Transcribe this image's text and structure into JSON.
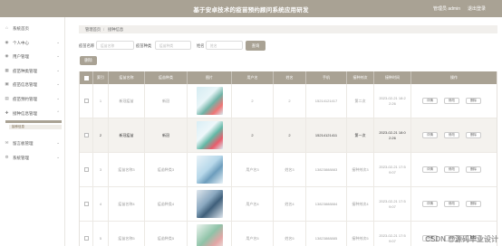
{
  "header": {
    "title": "基于安卓技术的疫苗预约顾问系统应用研发",
    "admin": "管理员 admin",
    "logout": "退出登录"
  },
  "sidebar": {
    "items": [
      {
        "label": "系统首页",
        "icon": "home-icon"
      },
      {
        "label": "个人中心",
        "icon": "user-icon"
      },
      {
        "label": "用户管理",
        "icon": "users-icon"
      },
      {
        "label": "疫苗种类管理",
        "icon": "grid-icon"
      },
      {
        "label": "疫苗信息管理",
        "icon": "box-icon"
      },
      {
        "label": "疫苗预约管理",
        "icon": "calendar-icon"
      },
      {
        "label": "接种信息管理",
        "icon": "syringe-icon"
      },
      {
        "label": "留言板管理",
        "icon": "message-icon"
      },
      {
        "label": "系统管理",
        "icon": "gear-icon"
      }
    ],
    "sub_item": "接种信息"
  },
  "breadcrumb": {
    "home": "管理首页",
    "current": "接种信息"
  },
  "search": {
    "field1_label": "疫苗名称",
    "field1_placeholder": "疫苗名称",
    "field2_label": "疫苗种类",
    "field2_placeholder": "疫苗种类",
    "field3_label": "姓名",
    "field3_placeholder": "姓名",
    "button": "查询"
  },
  "delete_button": "删除",
  "table": {
    "headers": [
      "",
      "索引",
      "疫苗名称",
      "疫苗种类",
      "图片",
      "用户名",
      "姓名",
      "手机",
      "接种剂次",
      "接种时间",
      "操作"
    ],
    "rows": [
      {
        "index": "1",
        "vaccine": "新冠疫苗",
        "kind": "新冠",
        "user": "2",
        "name": "2",
        "phone": "15214121417",
        "dose": "第二次",
        "time": "2023-02-21 18:2",
        "time2": "2:26",
        "image_colors": [
          "#6fb3a6",
          "#d5ecf2",
          "#f07575"
        ],
        "dim": true
      },
      {
        "index": "2",
        "vaccine": "新冠疫苗",
        "kind": "新冠",
        "user": "2",
        "name": "2",
        "phone": "15214121411",
        "dose": "第一次",
        "time": "2023-02-21 18:0",
        "time2": "2:26",
        "image_colors": [
          "#64b8a6",
          "#d8eef5",
          "#e95c6b"
        ],
        "dim": false
      },
      {
        "index": "3",
        "vaccine": "疫苗名称3",
        "kind": "疫苗种类3",
        "user": "用户名3",
        "name": "姓名3",
        "phone": "13823888883",
        "dose": "接种剂次3",
        "time": "2023-02-21 17:5",
        "time2": "9:07",
        "image_colors": [
          "#b7d8ea",
          "#e9f3f8",
          "#6d9dbc"
        ],
        "dim": true
      },
      {
        "index": "4",
        "vaccine": "疫苗名称4",
        "kind": "疫苗种类4",
        "user": "用户名4",
        "name": "姓名4",
        "phone": "13823888884",
        "dose": "接种剂次4",
        "time": "2023-02-21 17:5",
        "time2": "9:07",
        "image_colors": [
          "#3f5f7a",
          "#dfe7ee",
          "#8aa8c0"
        ],
        "dim": true
      },
      {
        "index": "5",
        "vaccine": "疫苗名称5",
        "kind": "疫苗种类5",
        "user": "用户名5",
        "name": "姓名5",
        "phone": "13823888885",
        "dose": "接种剂次5",
        "time": "2023-02-21 17:5",
        "time2": "9:07",
        "image_colors": [
          "#8fc3a8",
          "#eef5f0",
          "#e3a6a6"
        ],
        "dim": true
      }
    ],
    "actions": [
      "详情",
      "修改",
      "删除"
    ]
  },
  "watermark": "CSDN @源码毕业设计"
}
